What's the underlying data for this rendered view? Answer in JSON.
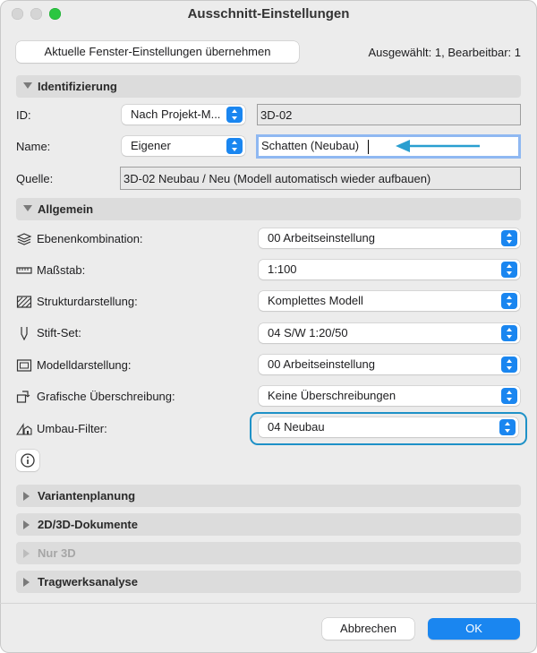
{
  "window": {
    "title": "Ausschnitt-Einstellungen"
  },
  "top": {
    "apply_button": "Aktuelle Fenster-Einstellungen übernehmen",
    "selection_status": "Ausgewählt: 1, Bearbeitbar: 1"
  },
  "identification": {
    "header": "Identifizierung",
    "id_label": "ID:",
    "id_mode": "Nach Projekt-M...",
    "id_value": "3D-02",
    "name_label": "Name:",
    "name_mode": "Eigener",
    "name_value": "Schatten (Neubau)",
    "source_label": "Quelle:",
    "source_value": "3D-02 Neubau / Neu (Modell automatisch wieder aufbauen)"
  },
  "general": {
    "header": "Allgemein",
    "rows": [
      {
        "label": "Ebenenkombination:",
        "value": "00 Arbeitseinstellung",
        "icon": "layers-icon"
      },
      {
        "label": "Maßstab:",
        "value": "1:100",
        "icon": "ruler-icon"
      },
      {
        "label": "Strukturdarstellung:",
        "value": "Komplettes Modell",
        "icon": "structure-icon"
      },
      {
        "label": "Stift-Set:",
        "value": "04 S/W 1:20/50",
        "icon": "pen-icon"
      },
      {
        "label": "Modelldarstellung:",
        "value": "00 Arbeitseinstellung",
        "icon": "model-display-icon"
      },
      {
        "label": "Grafische Überschreibung:",
        "value": "Keine Überschreibungen",
        "icon": "graphic-override-icon"
      },
      {
        "label": "Umbau-Filter:",
        "value": "04 Neubau",
        "icon": "renovation-filter-icon"
      }
    ],
    "info_icon": "info-icon"
  },
  "collapsed_sections": [
    {
      "label": "Variantenplanung",
      "enabled": true
    },
    {
      "label": "2D/3D-Dokumente",
      "enabled": true
    },
    {
      "label": "Nur 3D",
      "enabled": false
    },
    {
      "label": "Tragwerksanalyse",
      "enabled": true
    }
  ],
  "footer": {
    "cancel": "Abbrechen",
    "ok": "OK"
  },
  "colors": {
    "accent": "#1a86f0",
    "highlight": "#1e91c7",
    "arrow": "#2a9fd0"
  }
}
